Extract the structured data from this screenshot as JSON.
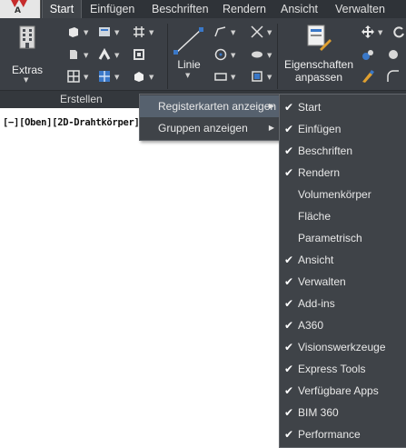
{
  "app_button": {
    "logo_letter": "A"
  },
  "tabs": [
    {
      "label": "Start",
      "active": true
    },
    {
      "label": "Einfügen"
    },
    {
      "label": "Beschriften"
    },
    {
      "label": "Rendern"
    },
    {
      "label": "Ansicht"
    },
    {
      "label": "Verwalten"
    }
  ],
  "ribbon": {
    "extras_label": "Extras",
    "linie_label": "Linie",
    "eigenschaften_label_1": "Eigenschaften",
    "eigenschaften_label_2": "anpassen",
    "group_label": "Erstellen"
  },
  "viewport": {
    "label": "[−][Oben][2D-Drahtkörper]"
  },
  "context_menu": {
    "items": [
      {
        "label": "Registerkarten anzeigen",
        "highlighted": true,
        "submenu": true
      },
      {
        "label": "Gruppen anzeigen",
        "submenu": true
      }
    ]
  },
  "submenu": {
    "items": [
      {
        "label": "Start",
        "checked": true
      },
      {
        "label": "Einfügen",
        "checked": true
      },
      {
        "label": "Beschriften",
        "checked": true
      },
      {
        "label": "Rendern",
        "checked": true
      },
      {
        "label": "Volumenkörper",
        "checked": false
      },
      {
        "label": "Fläche",
        "checked": false
      },
      {
        "label": "Parametrisch",
        "checked": false
      },
      {
        "label": "Ansicht",
        "checked": true
      },
      {
        "label": "Verwalten",
        "checked": true
      },
      {
        "label": "Add-ins",
        "checked": true
      },
      {
        "label": "A360",
        "checked": true
      },
      {
        "label": "Visionswerkzeuge",
        "checked": true
      },
      {
        "label": "Express Tools",
        "checked": true
      },
      {
        "label": "Verfügbare Apps",
        "checked": true
      },
      {
        "label": "BIM 360",
        "checked": true
      },
      {
        "label": "Performance",
        "checked": true
      }
    ],
    "check_glyph": "✔"
  },
  "colors": {
    "ribbon_bg": "#3b3f45",
    "menu_bg": "#3f4348",
    "highlight": "#56616e",
    "logo_red": "#c62b2b"
  }
}
